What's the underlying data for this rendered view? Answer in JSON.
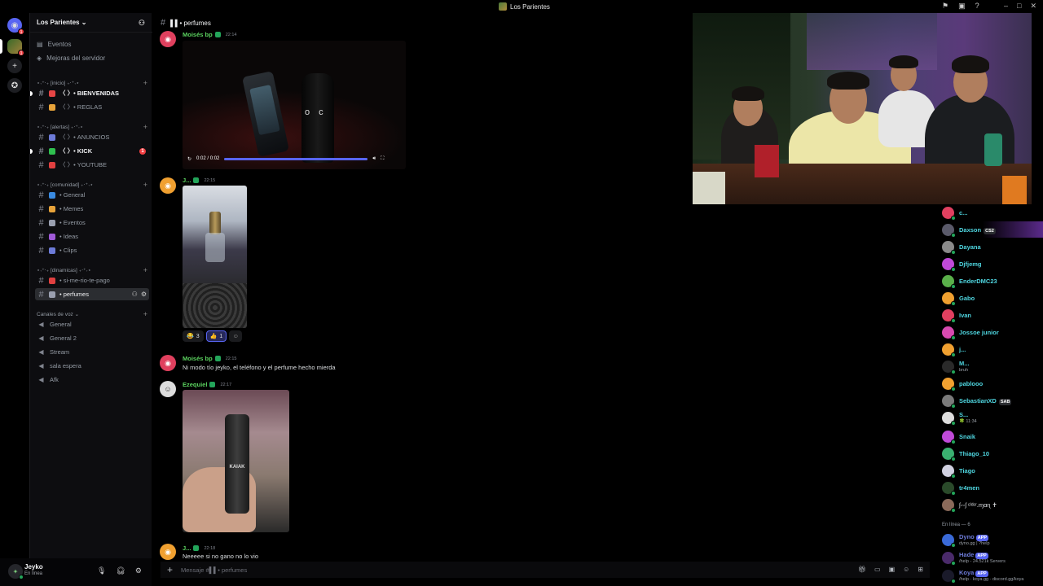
{
  "window": {
    "title": "Los Parientes"
  },
  "server": {
    "name": "Los Parientes",
    "rail_badge": "1",
    "rail_badge_2": "1"
  },
  "sidebar": {
    "top_items": [
      {
        "label": "Eventos",
        "icon": "calendar-icon"
      },
      {
        "label": "Mejoras del servidor",
        "icon": "boost-icon"
      }
    ],
    "categories": [
      {
        "label": "⋆˖⁺‧₊ [inicio] ₊‧⁺˖⋆"
      },
      {
        "label": "⋆˖⁺‧₊ [alertas] ₊‧⁺˖⋆"
      },
      {
        "label": "⋆˖⁺‧₊ [comunidad] ₊‧⁺˖⋆"
      },
      {
        "label": "⋆˖⁺‧₊ [dinamicas] ₊‧⁺˖⋆"
      }
    ],
    "channels": [
      {
        "label": "〈 〉• BIENVENIDAS",
        "color": "#e64545"
      },
      {
        "label": "〈 〉• REGLAS",
        "color": "#e8a33a"
      },
      {
        "label": "〈 〉• ANUNCIOS",
        "color": "#6d7bd8"
      },
      {
        "label": "〈 〉• KICK",
        "color": "#2fbf4f",
        "badge": "1"
      },
      {
        "label": "〈 〉• YOUTUBE",
        "color": "#e04040"
      },
      {
        "label": "• General",
        "color": "#3a8ae0"
      },
      {
        "label": "• Memes",
        "color": "#e8a33a"
      },
      {
        "label": "• Eventos",
        "color": "#9aa0b0"
      },
      {
        "label": "• Ideas",
        "color": "#a05ad8"
      },
      {
        "label": "• Clips",
        "color": "#6d7bd8"
      },
      {
        "label": "• si-me-rio-te-pago",
        "color": "#e04040"
      },
      {
        "label": "• perfumes",
        "color": "#9aa0b0"
      }
    ],
    "voice_header": "Canales de voz",
    "voice_channels": [
      "General",
      "General 2",
      "Stream",
      "sala espera",
      "Afk"
    ]
  },
  "user": {
    "name": "Jeyko",
    "status": "En línea"
  },
  "chat": {
    "channel_name": "▌▌• perfumes",
    "placeholder": "Mensaje #▌▌• perfumes",
    "video": {
      "time": "0:02 / 0:02",
      "progress": 1.0,
      "bottle_text": "o c"
    },
    "messages": [
      {
        "author": "Moisés bp",
        "time": "22:14"
      },
      {
        "author": "J...",
        "time": "22:15"
      },
      {
        "author": "Moisés bp",
        "time": "22:15",
        "text": "Ni modo tío jeyko, el teléfono y el perfume hecho mierda"
      },
      {
        "author": "Ezequiel",
        "time": "22:17",
        "bottle_label": "KAIAK"
      },
      {
        "author": "J...",
        "time": "22:18",
        "text": "Neeeee si no gano no lo vio"
      }
    ],
    "reactions": [
      {
        "emoji": "😂",
        "count": "3"
      },
      {
        "emoji": "👍",
        "count": "1"
      },
      {
        "emoji": "☺",
        "count": ""
      }
    ]
  },
  "members": {
    "list": [
      {
        "name": "c...",
        "color": "#e04060"
      },
      {
        "name": "Daxson",
        "tag": "CS2",
        "color": "#5a5a6a"
      },
      {
        "name": "Dayana",
        "color": "#8a8a8a"
      },
      {
        "name": "Djfjemg",
        "color": "#c04ad8"
      },
      {
        "name": "EnderDMC23",
        "color": "#5ab04a"
      },
      {
        "name": "Gabo",
        "color": "#f0a030"
      },
      {
        "name": "Ivan",
        "color": "#e04060"
      },
      {
        "name": "Jossoe junior",
        "color": "#d84ab0"
      },
      {
        "name": "j...",
        "color": "#f0a030"
      },
      {
        "name": "M...",
        "sub": "bruh",
        "color": "#2a2a2a"
      },
      {
        "name": "pablooo",
        "color": "#f0a030"
      },
      {
        "name": "SebastianXD",
        "tag": "SAB",
        "color": "#7a7a7a"
      },
      {
        "name": "S...",
        "sub": "🍀 11:34",
        "color": "#dddddd"
      },
      {
        "name": "Snaik",
        "color": "#c04ad8"
      },
      {
        "name": "Thiago_10",
        "color": "#3ab070"
      },
      {
        "name": "Tiago",
        "color": "#d0d0e0"
      },
      {
        "name": "tr4men",
        "color": "#2a4a2a"
      },
      {
        "name": "ʃᵕᵕʃ ᵋᴵᵈᵋʳ.ɱɑɳ ✝",
        "color": "#8a6a5a"
      }
    ],
    "online_header": "En línea — 6",
    "bots": [
      {
        "name": "Dyno",
        "badge": "APP",
        "sub": "dyno.gg | ?help",
        "color": "#3a6ad8"
      },
      {
        "name": "Hade",
        "badge": "APP",
        "sub": "/help - 24.521k Servers",
        "color": "#4a2a6a"
      },
      {
        "name": "Koya",
        "badge": "APP",
        "sub": "/help · koya.gg · discord.gg/koya",
        "color": "#1a1a2a"
      }
    ]
  }
}
